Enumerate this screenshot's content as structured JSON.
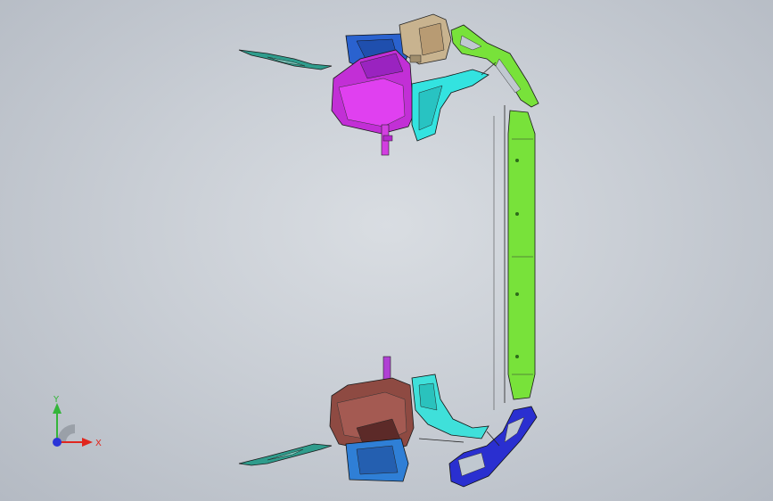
{
  "viewport": {
    "background_top": "#d9dde2",
    "background_bottom": "#b4bac3"
  },
  "model": {
    "parts": [
      {
        "name": "upper-wheelhouse-magenta",
        "color": "#c22fd6"
      },
      {
        "name": "upper-wheelhouse-cyan",
        "color": "#33e3e0"
      },
      {
        "name": "upper-bracket-blue",
        "color": "#2a62cf"
      },
      {
        "name": "upper-bracket-tan",
        "color": "#c8b38f"
      },
      {
        "name": "side-rail-green",
        "color": "#78e23a"
      },
      {
        "name": "lower-wheelhouse-brown",
        "color": "#8e4a42"
      },
      {
        "name": "lower-wheelhouse-cyan",
        "color": "#3fe0da"
      },
      {
        "name": "lower-bracket-blue",
        "color": "#2a2fd0"
      },
      {
        "name": "lower-mount-bracket-blue",
        "color": "#2f7fd6"
      },
      {
        "name": "teal-flange",
        "color": "#2f9c8c"
      }
    ]
  },
  "triad": {
    "x_label": "X",
    "y_label": "Y",
    "x_color": "#e0261e",
    "y_color": "#34b53a",
    "z_color": "#2b35d8"
  }
}
